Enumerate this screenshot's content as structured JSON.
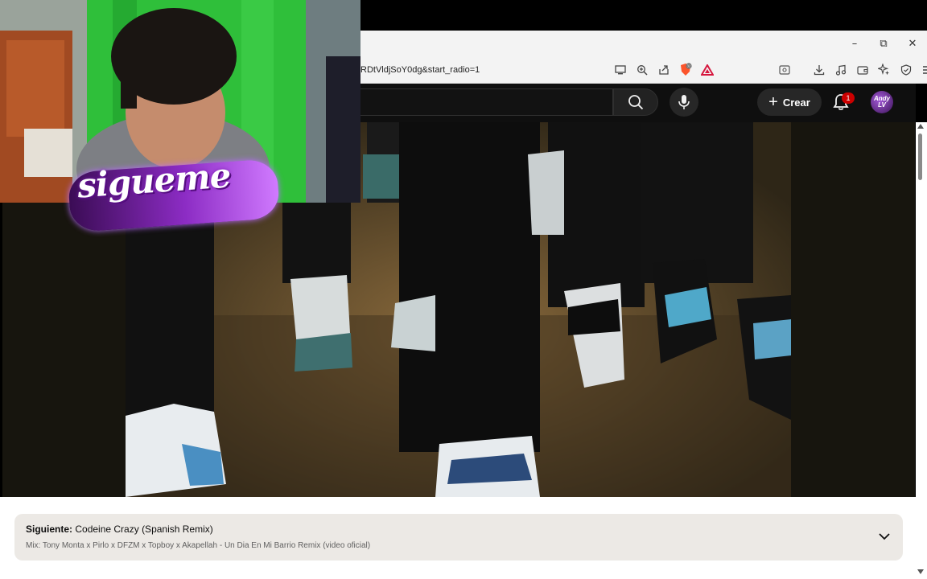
{
  "browser": {
    "url_visible": "RDtVldjSoY0dg&start_radio=1",
    "window_controls": {
      "minimize": "–",
      "restore": "⧉",
      "close": "✕"
    },
    "url_icons": [
      "cast-icon",
      "zoom-icon",
      "share-icon",
      "brave-shield-icon",
      "rewards-icon"
    ],
    "tool_icons": [
      "reader-icon",
      "download-icon",
      "music-icon",
      "wallet-icon",
      "leo-icon",
      "vpn-icon",
      "menu-icon"
    ],
    "shield_badge": "32"
  },
  "youtube": {
    "create_label": "Crear",
    "notifications_count": "1",
    "avatar_text": "Andy LV"
  },
  "webcam": {
    "sticker_text": "sigueme"
  },
  "up_next": {
    "label": "Siguiente:",
    "title": "Codeine Crazy (Spanish Remix)",
    "playlist": "Mix: Tony Monta x Pirlo x DFZM x Topboy x Akapellah - Un Dia En Mi Barrio Remix (video oficial)"
  }
}
